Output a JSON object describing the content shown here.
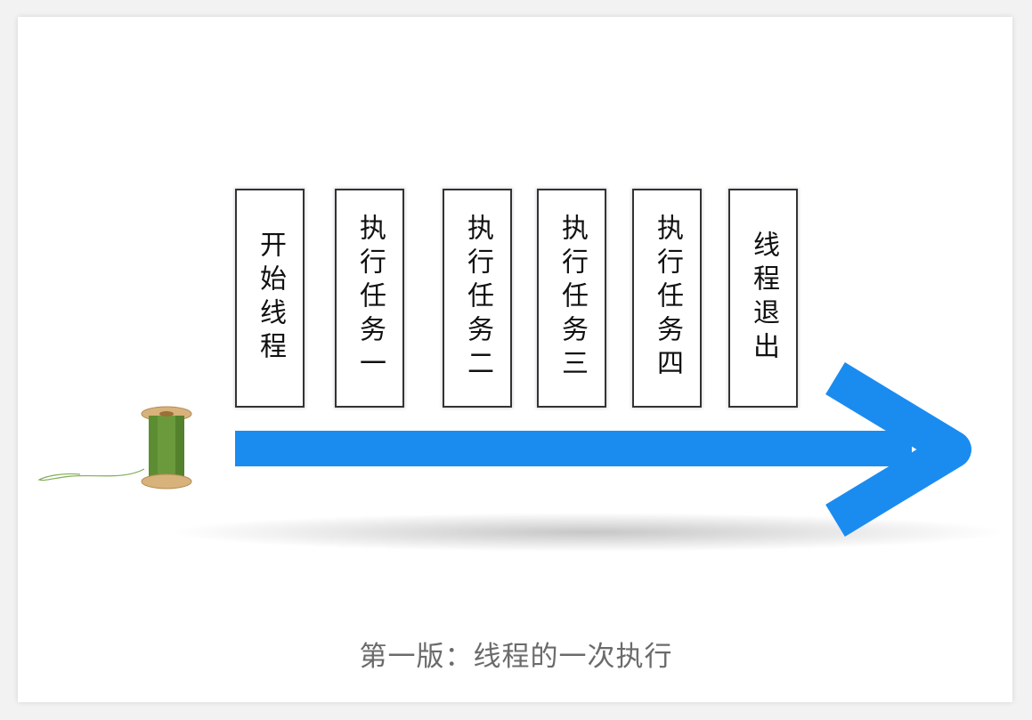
{
  "diagram": {
    "steps": [
      {
        "label": "开始线程"
      },
      {
        "label": "执行任务一"
      },
      {
        "label": "执行任务二"
      },
      {
        "label": "执行任务三"
      },
      {
        "label": "执行任务四"
      },
      {
        "label": "线程退出"
      }
    ],
    "caption": "第一版：线程的一次执行",
    "arrow_color": "#1a8cf0",
    "spool_thread_color": "#6a9a3c",
    "spool_wood_color": "#d7b27a"
  }
}
